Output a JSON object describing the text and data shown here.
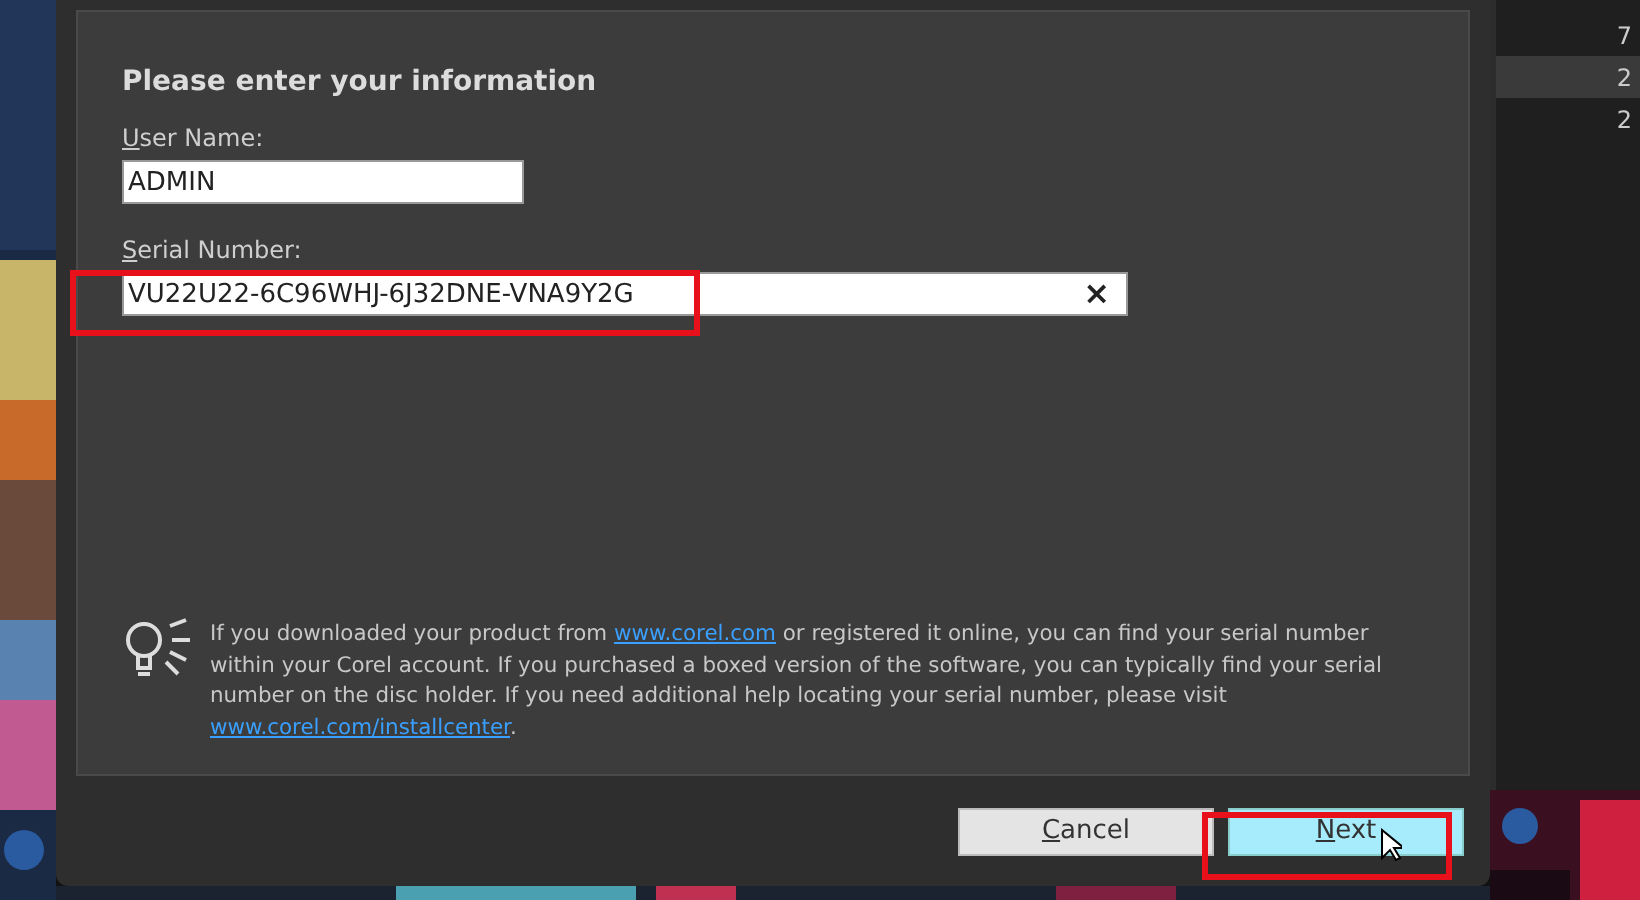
{
  "dialog": {
    "heading": "Please enter your information",
    "fields": [
      {
        "label": "User Name:",
        "value": "ADMIN",
        "kind": "plain"
      },
      {
        "label": "Serial Number:",
        "value": "VU22U22-6C96WHJ-6J32DNE-VNA9Y2G",
        "kind": "clearable",
        "clear_glyph": "×"
      }
    ],
    "hint": [
      {
        "kind": "text",
        "text": "If you downloaded your product from "
      },
      {
        "kind": "link",
        "text": "www.corel.com"
      },
      {
        "kind": "text",
        "text": " or registered it online, you can find your serial number within your Corel account. If you purchased a boxed version of the software, you can typically find your serial number on the disc holder. If you need additional help locating your serial number, please visit "
      },
      {
        "kind": "link",
        "text": "www.corel.com/installcenter"
      },
      {
        "kind": "text",
        "text": "."
      }
    ],
    "buttons": [
      {
        "label": "Cancel",
        "hovered": false
      },
      {
        "label": "Next",
        "hovered": true
      }
    ]
  },
  "side_window": {
    "rows": [
      {
        "text": "7",
        "selected": false
      },
      {
        "text": "2",
        "selected": true
      },
      {
        "text": "2",
        "selected": false
      }
    ]
  }
}
